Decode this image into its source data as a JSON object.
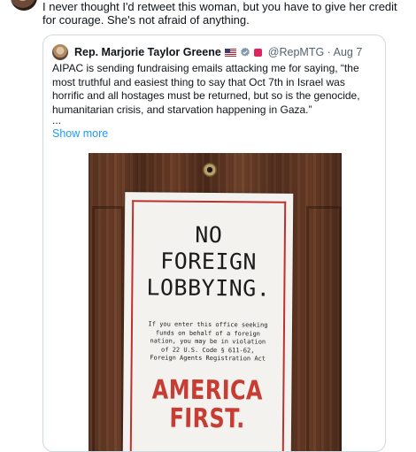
{
  "tweet": {
    "text": "I never thought I'd retweet this woman, but you have to give her credit for courage. She's not afraid of anything."
  },
  "quote": {
    "author_name": "Rep. Marjorie Taylor Greene",
    "handle_date": "@RepMTG · Aug 7",
    "text": "AIPAC is sending fundraising emails attacking me for saying, “the most truthful and easiest thing to say that Oct 7th in Israel was horrific and all hostages must be returned, but so is the genocide, humanitarian crisis, and starvation happening in Gaza.”",
    "ellipsis": "...",
    "show_more": "Show more",
    "icons": [
      "us-flag-icon",
      "verified-badge-icon",
      "red-square-badge-icon"
    ],
    "accent_color": "#1d9bf0"
  },
  "photo_sign": {
    "title_lines": [
      "NO",
      "FOREIGN",
      "LOBBYING."
    ],
    "body_lines": [
      "If you enter this office seeking",
      "funds on behalf of a foreign",
      "nation, you may be in violation",
      "of 22 U.S. Code § 611-62,",
      "Foreign Agents Registration Act"
    ],
    "slogan_lines": [
      "AMERICA",
      "FIRST."
    ],
    "slogan_color": "#c73d34"
  }
}
